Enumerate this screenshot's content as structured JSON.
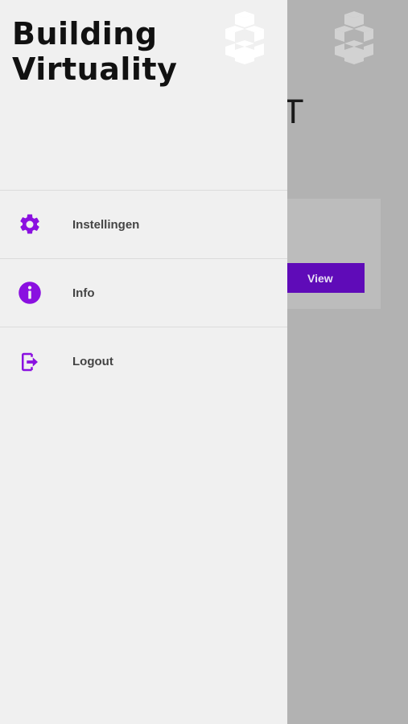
{
  "app": {
    "title_line1": "Building",
    "title_line2": "Virtuality"
  },
  "background": {
    "title_fragment": "T",
    "view_button_label": "View"
  },
  "drawer": {
    "items": [
      {
        "label": "Instellingen",
        "icon": "gear-icon"
      },
      {
        "label": "Info",
        "icon": "info-icon"
      },
      {
        "label": "Logout",
        "icon": "logout-icon"
      }
    ]
  },
  "colors": {
    "accent": "#8a10e0",
    "drawer_bg": "#f0f0f0",
    "overlay_bg": "#b2b2b2",
    "button_bg": "#5f0bb8"
  }
}
